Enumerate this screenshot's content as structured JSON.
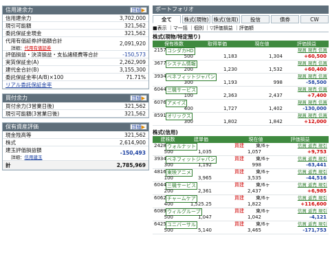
{
  "detail_label": "詳細",
  "left": {
    "credit": {
      "title": "信用建余力",
      "rows": [
        {
          "label": "信用建余力",
          "value": "3,702,000"
        },
        {
          "label": "現引可能額",
          "value": "321,562"
        },
        {
          "label": "委託保証金現金",
          "value": "321,562"
        },
        {
          "label": "代用有価証券評価額合計",
          "value": "2,091,920"
        },
        {
          "label": "詳細：",
          "link": "代用有価証券",
          "value": ""
        },
        {
          "label": "評価損益・決済損益・支払諸経費等合計",
          "value": "-150,573"
        },
        {
          "label": "実質保証金(A)",
          "value": "2,262,909"
        },
        {
          "label": "建代金合計(B)",
          "value": "3,155,300"
        },
        {
          "label": "委託保証金率(A/B)×100",
          "value": "71.71%"
        },
        {
          "label": "リアル委託保証金率",
          "value": ""
        }
      ]
    },
    "buying": {
      "title": "買付余力",
      "rows": [
        {
          "label": "買付余力(3営業日後)",
          "value": "321,562"
        },
        {
          "label": "現引可能額(3営業日後)",
          "value": "321,562"
        }
      ]
    },
    "assets": {
      "title": "保有資産評価",
      "rows": [
        {
          "label": "現金残高等",
          "value": "321,562"
        },
        {
          "label": "株式",
          "value": "2,614,900"
        },
        {
          "label": "建玉評価損益額",
          "value": ""
        },
        {
          "label": "詳細：",
          "link": "信用建玉",
          "value": "-150,493"
        },
        {
          "label": "計",
          "value": "2,785,969"
        }
      ]
    }
  },
  "right": {
    "title": "ポートフォリオ",
    "tabs": [
      "全て",
      "株式(現物)",
      "株式(信用)",
      "投信",
      "債券",
      "CW"
    ],
    "mode_bar": "■表示 ｜マ一括 ｜個別 ｜▽評価損益 ｜評価額",
    "spot": {
      "title": "株式(現物/特定預り)",
      "headers": [
        "保有株数",
        "取得単価",
        "現在値",
        "評価損益"
      ],
      "actions": "現買 現売 信買",
      "items": [
        {
          "code": "2157",
          "name": "コシダカHD",
          "shares": "500",
          "cost": "1,183",
          "price": "1,304",
          "pl": "+60,500"
        },
        {
          "code": "3677",
          "name": "システム情報",
          "shares": "200",
          "cost": "1,230",
          "price": "1,532",
          "pl": "+60,400"
        },
        {
          "code": "3934",
          "name": "ベネフィットジャパン",
          "shares": "300",
          "cost": "1,193",
          "price": "998",
          "pl": "-58,500"
        },
        {
          "code": "6044",
          "name": "三機サービス",
          "shares": "100",
          "cost": "2,363",
          "price": "2,437",
          "pl": "+7,400"
        },
        {
          "code": "6076",
          "name": "アメイズ",
          "shares": "400",
          "cost": "1,727",
          "price": "1,402",
          "pl": "-130,000"
        },
        {
          "code": "8591",
          "name": "オリックス",
          "shares": "300",
          "cost": "1,802",
          "price": "1,842",
          "pl": "+12,000"
        }
      ]
    },
    "margin": {
      "title": "株式(信用)",
      "headers": [
        "建株数",
        "建単価",
        "",
        "現在値",
        "評価損益"
      ],
      "actions": "信買 返売 現引",
      "items": [
        {
          "code": "2428",
          "name": "ウォルナット",
          "type": "買建",
          "term": "東/6ヶ",
          "shares": "500",
          "cost": "1,035",
          "price": "1,057",
          "pl": "+9,753"
        },
        {
          "code": "3934",
          "name": "ベネフィットジャパン",
          "type": "買建",
          "term": "東/6ヶ",
          "shares": "300",
          "cost": "1,192",
          "price": "998",
          "pl": "-63,441"
        },
        {
          "code": "4816",
          "name": "東映アニメ",
          "type": "買建",
          "term": "東/6ヶ",
          "shares": "100",
          "cost": "3,965",
          "price": "3,535",
          "pl": "-44,516"
        },
        {
          "code": "6044",
          "name": "三機サービス",
          "type": "買建",
          "term": "東/6ヶ",
          "shares": "200",
          "cost": "2,361",
          "price": "2,437",
          "pl": "+6,985"
        },
        {
          "code": "6062",
          "name": "チャームケア",
          "type": "買建",
          "term": "東/6ヶ",
          "shares": "400",
          "cost": "1,525.25",
          "price": "1,822",
          "pl": "+116,600"
        },
        {
          "code": "6089",
          "name": "ウィルグループ",
          "type": "買建",
          "term": "東/6ヶ",
          "shares": "500",
          "cost": "1,047",
          "price": "1,042",
          "pl": "-4,121"
        },
        {
          "code": "6425",
          "name": "ユニバーサル",
          "type": "買建",
          "term": "東/6ヶ",
          "shares": "500",
          "cost": "5,140",
          "price": "3,465",
          "pl": "-171,753"
        }
      ]
    }
  }
}
